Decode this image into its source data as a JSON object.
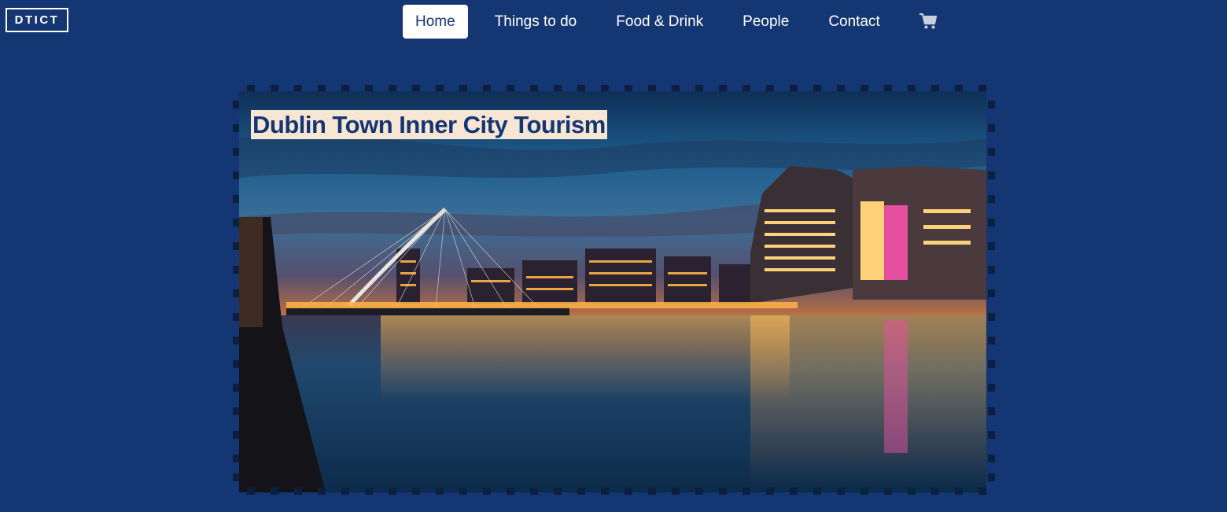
{
  "brand": {
    "logo_text": "DTICT"
  },
  "nav": {
    "items": [
      {
        "label": "Home",
        "active": true
      },
      {
        "label": "Things to do",
        "active": false
      },
      {
        "label": "Food & Drink",
        "active": false
      },
      {
        "label": "People",
        "active": false
      },
      {
        "label": "Contact",
        "active": false
      }
    ],
    "cart_icon": "shopping-cart-icon"
  },
  "hero": {
    "title": "Dublin Town Inner City Tourism",
    "image_subject": "Dublin skyline at dusk over the River Liffey with a harp-shaped cable bridge and illuminated buildings"
  },
  "colors": {
    "background": "#143672",
    "nav_active_bg": "#ffffff",
    "title_bg": "#f7e6d3",
    "title_text": "#143672"
  }
}
